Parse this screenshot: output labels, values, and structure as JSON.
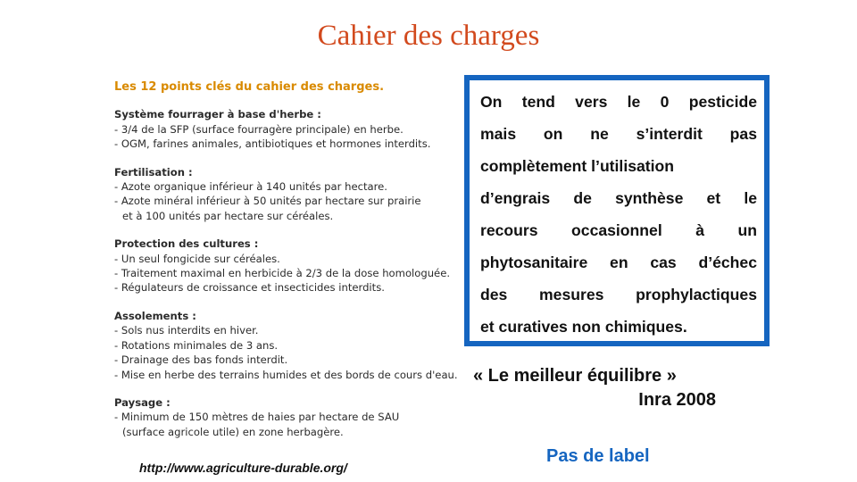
{
  "title": "Cahier des charges",
  "panel": {
    "heading": "Les 12 points clés du cahier des charges.",
    "sections": [
      {
        "title": "Système fourrager à base d'herbe :",
        "lines": [
          "- 3/4 de la SFP (surface fourragère principale) en herbe.",
          "- OGM, farines animales, antibiotiques et hormones interdits."
        ]
      },
      {
        "title": "Fertilisation :",
        "lines": [
          "- Azote organique inférieur à 140 unités par hectare.",
          "- Azote minéral inférieur à 50 unités par hectare sur prairie",
          "et à 100 unités par hectare sur céréales."
        ]
      },
      {
        "title": "Protection des cultures :",
        "lines": [
          "- Un seul fongicide sur céréales.",
          "- Traitement maximal en herbicide à 2/3 de la dose homologuée.",
          "- Régulateurs de croissance et insecticides interdits."
        ]
      },
      {
        "title": "Assolements :",
        "lines": [
          "- Sols nus interdits en hiver.",
          "- Rotations minimales de 3 ans.",
          "- Drainage des bas fonds interdit.",
          "- Mise en herbe des terrains humides et des bords de cours d'eau."
        ]
      },
      {
        "title": "Paysage :",
        "lines": [
          "- Minimum de 150 mètres de haies par hectare de SAU",
          "(surface agricole utile) en zone herbagère."
        ]
      }
    ]
  },
  "source_url": "http://www.agriculture-durable.org/",
  "quote": {
    "lines": [
      "On tend vers le 0 pesticide",
      "mais on ne s’interdit pas",
      "complètement l’utilisation",
      "d’engrais de synthèse et le",
      "recours occasionnel à un",
      "phytosanitaire en cas d’échec",
      "des mesures prophylactiques",
      "et curatives non chimiques."
    ],
    "border_color": "#1565c0"
  },
  "equilibre": {
    "quote": "« Le meilleur équilibre »",
    "source": "Inra 2008"
  },
  "label_text": "Pas de label",
  "colors": {
    "title": "#d24a1e",
    "heading": "#d98a00",
    "accent_blue": "#1565c0"
  }
}
